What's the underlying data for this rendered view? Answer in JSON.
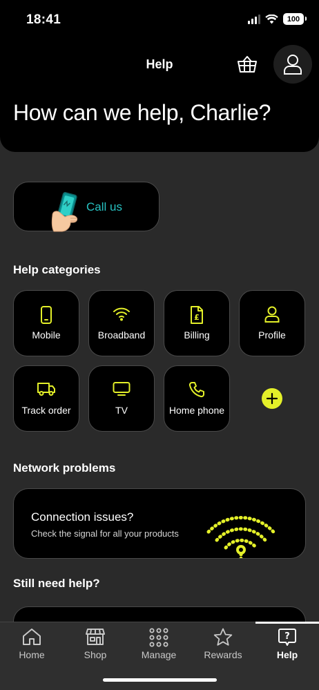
{
  "status_bar": {
    "time": "18:41",
    "battery": "100"
  },
  "header": {
    "title": "Help",
    "greeting": "How can we help, Charlie?"
  },
  "call_us": {
    "label": "Call us",
    "icon": "hand-phone-icon"
  },
  "help_categories": {
    "title": "Help categories",
    "items": [
      {
        "label": "Mobile",
        "icon": "mobile-icon"
      },
      {
        "label": "Broadband",
        "icon": "wifi-icon"
      },
      {
        "label": "Billing",
        "icon": "bill-icon"
      },
      {
        "label": "Profile",
        "icon": "user-icon"
      },
      {
        "label": "Track order",
        "icon": "van-icon"
      },
      {
        "label": "TV",
        "icon": "tv-icon"
      },
      {
        "label": "Home phone",
        "icon": "phone-icon"
      }
    ],
    "more_icon": "plus-icon"
  },
  "network_problems": {
    "title": "Network problems",
    "card_title": "Connection issues?",
    "card_subtitle": "Check the signal for all your products"
  },
  "still_need_help": {
    "title": "Still need help?"
  },
  "bottom_nav": {
    "items": [
      {
        "label": "Home",
        "icon": "home-icon"
      },
      {
        "label": "Shop",
        "icon": "shop-icon"
      },
      {
        "label": "Manage",
        "icon": "grid-icon"
      },
      {
        "label": "Rewards",
        "icon": "star-icon"
      },
      {
        "label": "Help",
        "icon": "help-icon",
        "active": true
      }
    ]
  },
  "colors": {
    "accent": "#e4f029",
    "call_text": "#27c2c2",
    "background": "#2a2a2a",
    "card": "#000000"
  }
}
